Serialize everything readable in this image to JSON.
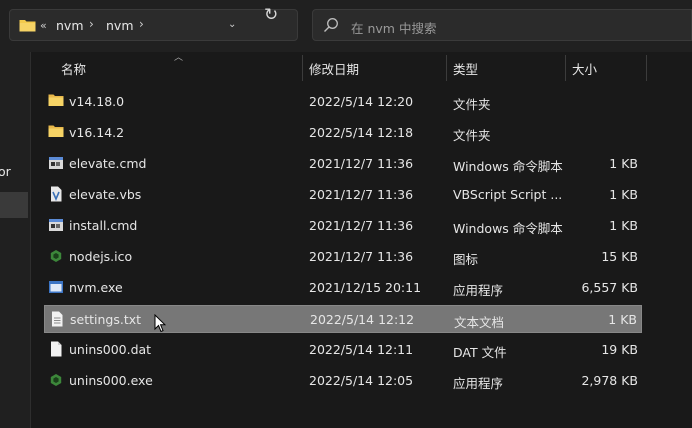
{
  "address": {
    "overflow": "«",
    "crumbs": [
      "nvm",
      "nvm"
    ]
  },
  "search": {
    "placeholder": "在 nvm 中搜索"
  },
  "nav": {
    "partial_label": "or"
  },
  "columns": {
    "name": "名称",
    "date": "修改日期",
    "type": "类型",
    "size": "大小"
  },
  "files": [
    {
      "name": "v14.18.0",
      "date": "2022/5/14 12:20",
      "type": "文件夹",
      "size": "",
      "icon": "folder-icon",
      "selected": false
    },
    {
      "name": "v16.14.2",
      "date": "2022/5/14 12:18",
      "type": "文件夹",
      "size": "",
      "icon": "folder-icon",
      "selected": false
    },
    {
      "name": "elevate.cmd",
      "date": "2021/12/7 11:36",
      "type": "Windows 命令脚本",
      "size": "1 KB",
      "icon": "cmd-file-icon",
      "selected": false
    },
    {
      "name": "elevate.vbs",
      "date": "2021/12/7 11:36",
      "type": "VBScript Script ...",
      "size": "1 KB",
      "icon": "vbs-file-icon",
      "selected": false
    },
    {
      "name": "install.cmd",
      "date": "2021/12/7 11:36",
      "type": "Windows 命令脚本",
      "size": "1 KB",
      "icon": "cmd-file-icon",
      "selected": false
    },
    {
      "name": "nodejs.ico",
      "date": "2021/12/7 11:36",
      "type": "图标",
      "size": "15 KB",
      "icon": "nodejs-icon",
      "selected": false
    },
    {
      "name": "nvm.exe",
      "date": "2021/12/15 20:11",
      "type": "应用程序",
      "size": "6,557 KB",
      "icon": "exe-icon",
      "selected": false
    },
    {
      "name": "settings.txt",
      "date": "2022/5/14 12:12",
      "type": "文本文档",
      "size": "1 KB",
      "icon": "text-file-icon",
      "selected": true
    },
    {
      "name": "unins000.dat",
      "date": "2022/5/14 12:11",
      "type": "DAT 文件",
      "size": "19 KB",
      "icon": "blank-file-icon",
      "selected": false
    },
    {
      "name": "unins000.exe",
      "date": "2022/5/14 12:05",
      "type": "应用程序",
      "size": "2,978 KB",
      "icon": "nodejs-icon",
      "selected": false
    }
  ],
  "colors": {
    "accent_folder": "#f2c94c",
    "selection": "#777777",
    "background": "#191919"
  }
}
